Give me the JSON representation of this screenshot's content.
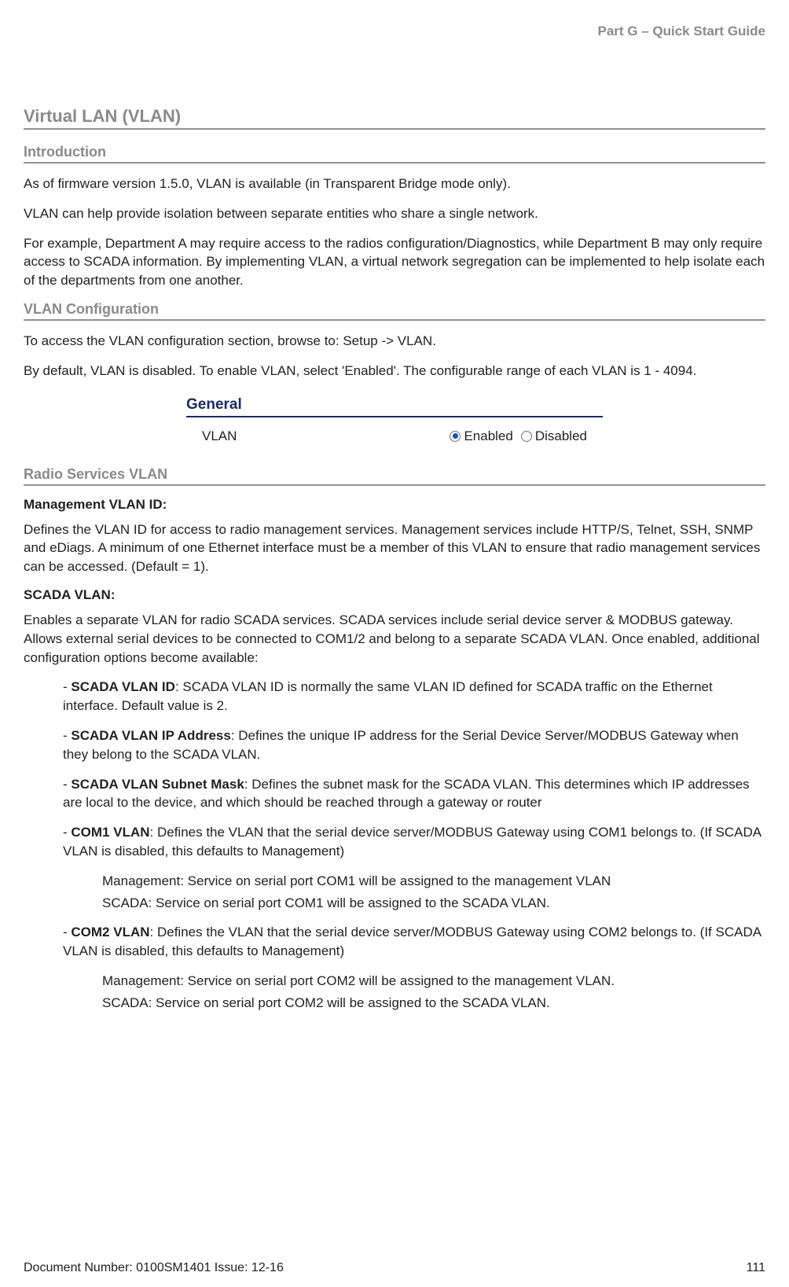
{
  "header": {
    "part": "Part G – Quick Start Guide"
  },
  "h1": "Virtual LAN (VLAN)",
  "intro": {
    "title": "Introduction",
    "p1": "As of firmware version 1.5.0, VLAN is available (in Transparent Bridge mode only).",
    "p2": "VLAN can help provide isolation between separate entities who share a single network.",
    "p3": "For example, Department A may require access to the radios configuration/Diagnostics, while Department B may only require access to SCADA information. By implementing VLAN, a virtual network segregation can be implemented to help isolate each of the departments from one another."
  },
  "config": {
    "title": "VLAN Configuration",
    "p1": "To access the VLAN configuration section, browse to: Setup -> VLAN.",
    "p2": "By default, VLAN is disabled. To enable VLAN, select 'Enabled'. The configurable range of each VLAN is 1 - 4094."
  },
  "widget": {
    "title": "General",
    "row_label": "VLAN",
    "opt_enabled": "Enabled",
    "opt_disabled": "Disabled"
  },
  "radio_h2": "Radio Services VLAN",
  "mgmt": {
    "label": "Management VLAN ID:",
    "body": "Defines the VLAN ID for access to radio management services. Management services include HTTP/S, Telnet, SSH, SNMP and eDiags. A minimum of one Ethernet interface must be a member of this VLAN to ensure that radio management services can be accessed. (Default = 1)."
  },
  "scada": {
    "label": "SCADA VLAN:",
    "body": "Enables a separate VLAN for radio SCADA services. SCADA services include serial device server & MODBUS gateway. Allows external serial devices to be connected to COM1/2 and belong to a separate SCADA VLAN. Once enabled, additional configuration options become available:",
    "b1_prefix": "- ",
    "b1_bold": "SCADA VLAN ID",
    "b1_rest": ": SCADA VLAN ID is normally the same VLAN ID defined for SCADA traffic on the Ethernet interface. Default value is 2.",
    "b2_prefix": "- ",
    "b2_bold": "SCADA VLAN IP Address",
    "b2_rest": ": Defines the unique IP address for the Serial Device Server/MODBUS Gateway when they belong to the SCADA VLAN.",
    "b3_prefix": "- ",
    "b3_bold": "SCADA VLAN Subnet Mask",
    "b3_rest": ": Defines the subnet mask for the SCADA VLAN. This determines which IP addresses are local to the device, and which should be reached through a gateway or router",
    "b4_prefix": "- ",
    "b4_bold": "COM1 VLAN",
    "b4_rest": ": Defines the VLAN that the serial device server/MODBUS Gateway using COM1 belongs to. (If SCADA VLAN is disabled, this defaults to Management)",
    "b4_s1": "Management: Service on serial port COM1 will be assigned to the management VLAN",
    "b4_s2": "SCADA: Service on serial port COM1 will be assigned to the SCADA VLAN.",
    "b5_prefix": "- ",
    "b5_bold": "COM2 VLAN",
    "b5_rest": ": Defines the VLAN that the serial device server/MODBUS Gateway using COM2 belongs to. (If SCADA VLAN is disabled, this defaults to Management)",
    "b5_s1": "Management: Service on serial port COM2 will be assigned to the management VLAN.",
    "b5_s2": "SCADA: Service on serial port COM2 will be assigned to the SCADA VLAN."
  },
  "footer": {
    "left": "Document Number: 0100SM1401   Issue: 12-16",
    "right": "111"
  }
}
